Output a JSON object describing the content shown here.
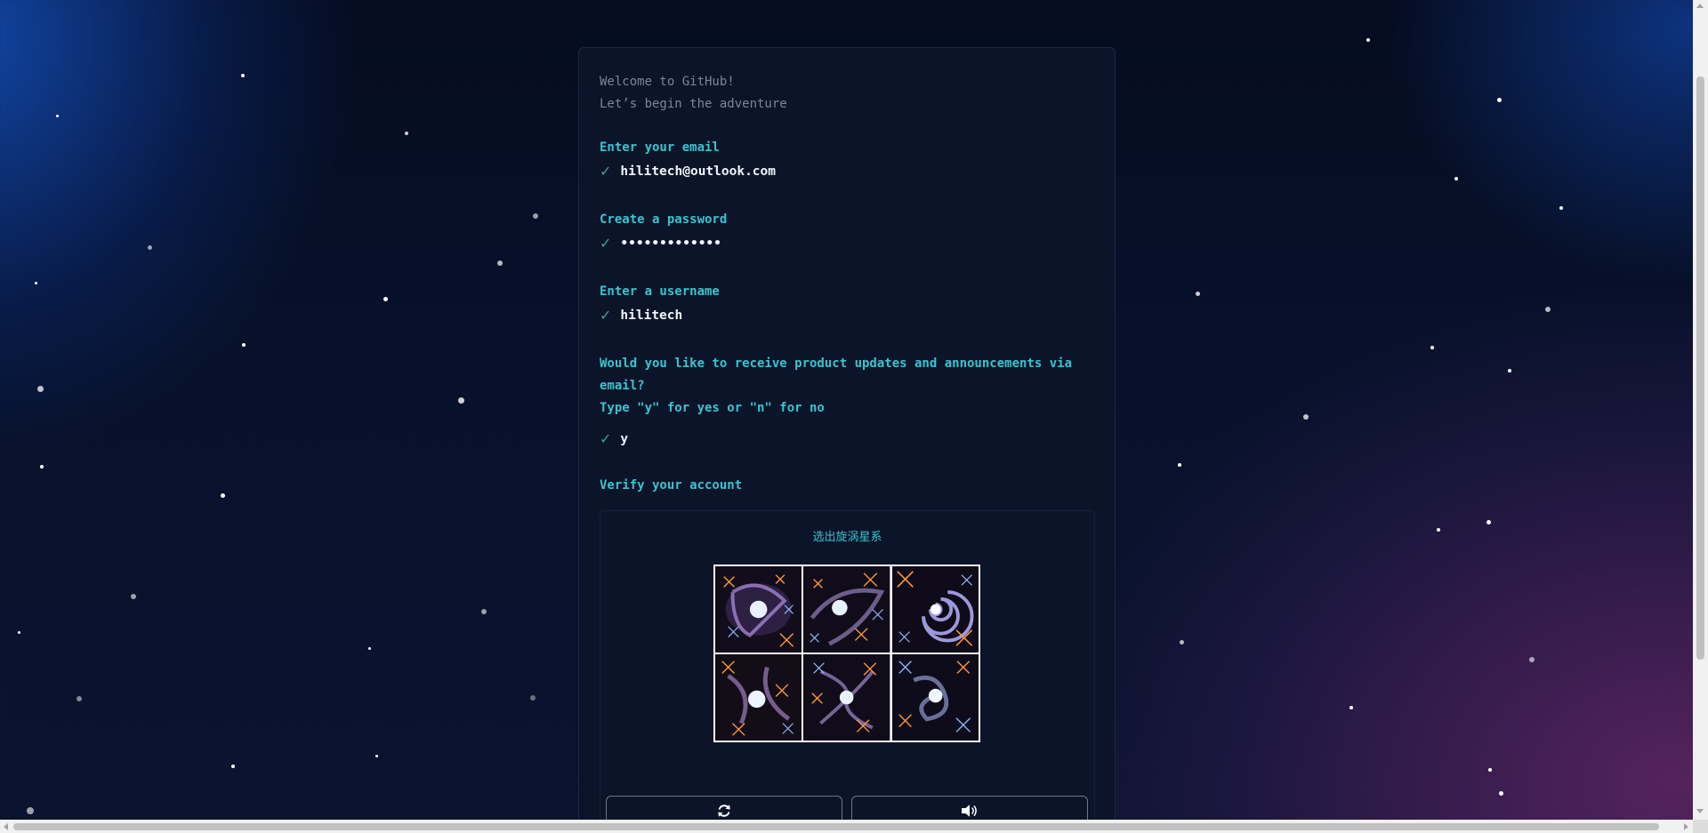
{
  "intro": {
    "line1": "Welcome to GitHub!",
    "line2": "Let’s begin the adventure"
  },
  "email": {
    "prompt": "Enter your email",
    "value": "hilitech@outlook.com"
  },
  "password": {
    "prompt": "Create a password",
    "value": "•••••••••••••"
  },
  "username": {
    "prompt": "Enter a username",
    "value": "hilitech"
  },
  "updates": {
    "prompt_line1": "Would you like to receive product updates and announcements via",
    "prompt_line2": "email?",
    "prompt_line3": "Type \"y\" for yes or \"n\" for no",
    "value": "y"
  },
  "verify": {
    "prompt": "Verify your account",
    "captcha_title": "选出旋涡星系",
    "tiles": [
      "galaxy-tile-1",
      "galaxy-tile-2",
      "galaxy-tile-3-spiral",
      "galaxy-tile-4",
      "galaxy-tile-5",
      "galaxy-tile-6"
    ],
    "refresh_icon": "refresh-icon",
    "audio_icon": "speaker-icon"
  },
  "icons": {
    "check": "✓"
  },
  "colors": {
    "accent": "#39c5cf",
    "check": "#2ea98f",
    "card_bg": "#0b1429",
    "text": "#f0f6fc"
  }
}
